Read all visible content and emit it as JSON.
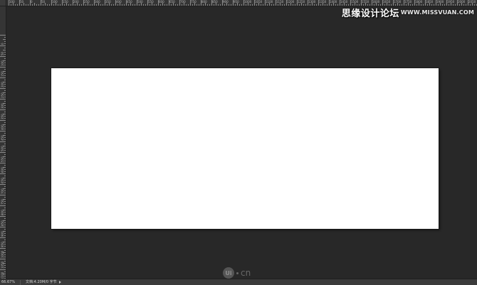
{
  "rulers": {
    "top_labels": [
      "100",
      "50",
      "0",
      "50",
      "100",
      "150",
      "200",
      "250",
      "300",
      "350",
      "400",
      "450",
      "500",
      "550",
      "600",
      "650",
      "700",
      "750",
      "800",
      "850",
      "900",
      "950",
      "1000",
      "1050",
      "1100",
      "1150",
      "1200",
      "1250",
      "1300",
      "1350",
      "1400",
      "1450",
      "1500",
      "1550",
      "1600",
      "1650",
      "1700",
      "1750",
      "1800",
      "1850",
      "1900",
      "1950",
      "2000",
      "2050"
    ],
    "left_labels": [
      "0",
      "50",
      "100",
      "150",
      "200",
      "250",
      "300",
      "350",
      "400",
      "450",
      "500",
      "550",
      "600",
      "650",
      "700",
      "750",
      "800",
      "850",
      "900",
      "950",
      "1000",
      "1050",
      "1100",
      "1150"
    ]
  },
  "watermark": {
    "top_cn": "思缘设计论坛",
    "top_site": "WWW.MISSVUAN.COM",
    "bottom_logo": "Ui",
    "bottom_suffix": "cn"
  },
  "status_bar": {
    "zoom": "66.67%",
    "doc_info": "文档:4.20M/0 字节"
  },
  "colors": {
    "workspace": "#282828",
    "canvas": "#ffffff",
    "ruler": "#353535",
    "status_bar": "#3b3b3b"
  }
}
